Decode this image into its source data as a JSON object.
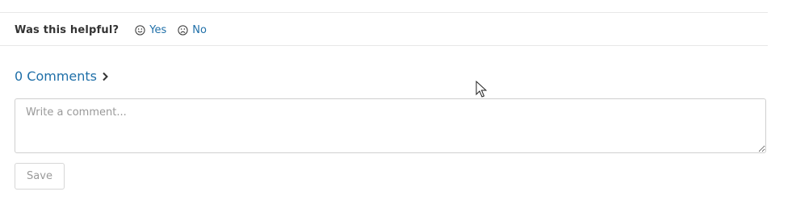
{
  "feedback": {
    "question": "Was this helpful?",
    "yes": {
      "label": "Yes",
      "icon": "smile-icon"
    },
    "no": {
      "label": "No",
      "icon": "frown-icon"
    }
  },
  "comments": {
    "title": "0 Comments",
    "icon": "chevron-right-icon",
    "placeholder": "Write a comment...",
    "save_label": "Save"
  },
  "colors": {
    "link": "#1f6fa8",
    "text": "#333333",
    "border": "#cfcfcf",
    "divider": "#e8e8e8",
    "muted": "#999999"
  }
}
